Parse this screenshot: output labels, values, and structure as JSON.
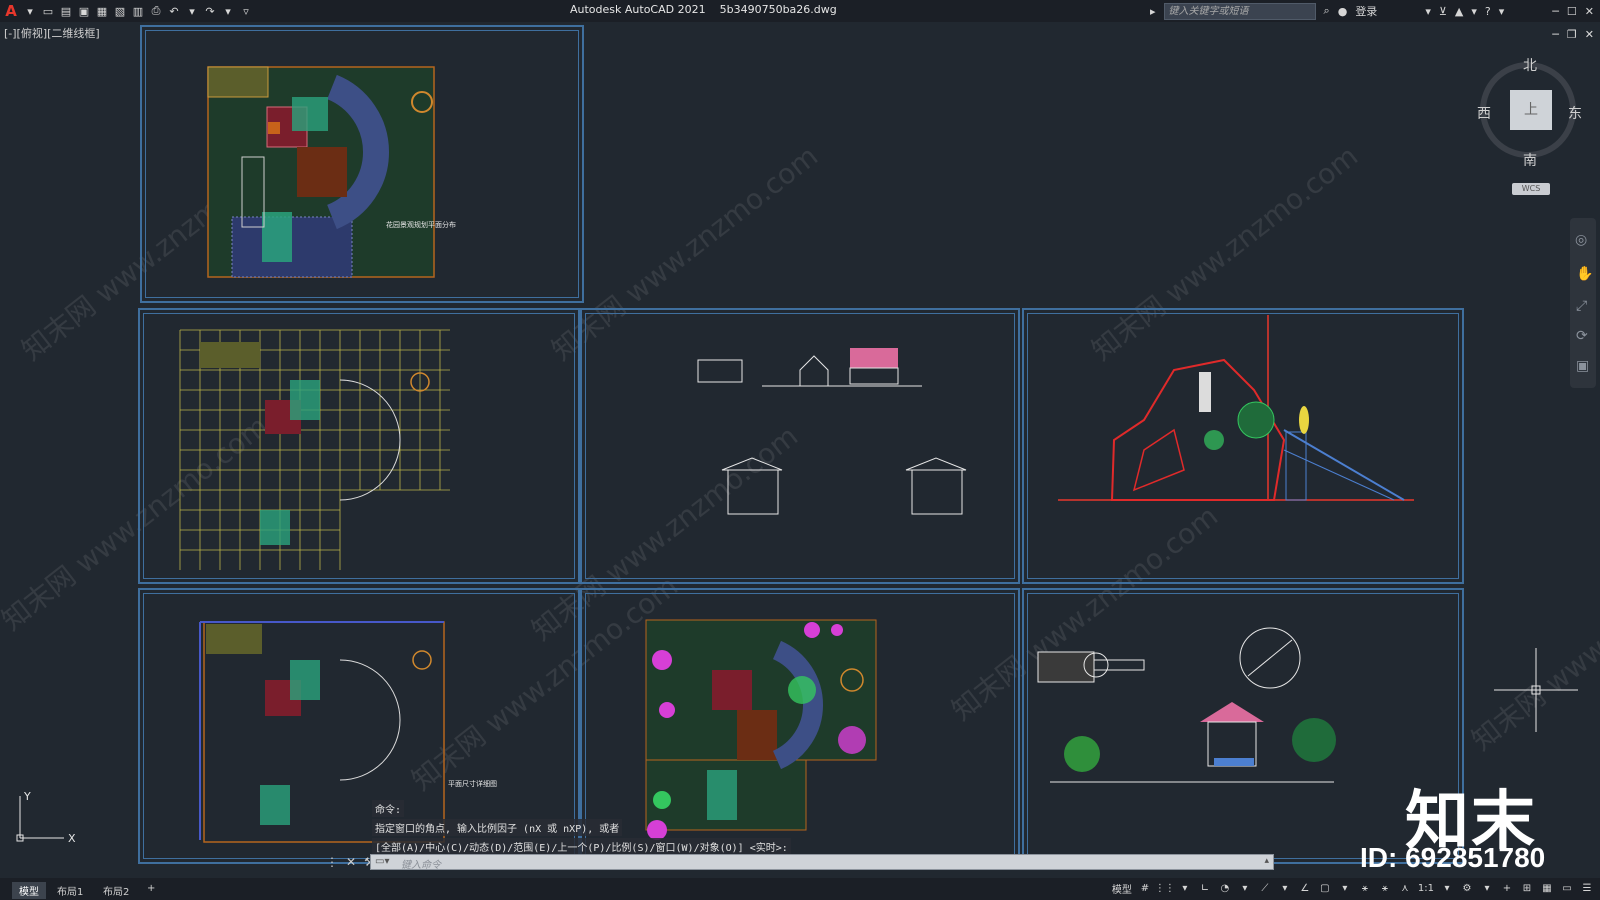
{
  "window": {
    "title": "Autodesk AutoCAD 2021",
    "filename": "5b3490750ba26.dwg",
    "search_placeholder": "键入关键字或短语",
    "login_label": "登录",
    "view_label": "[-][俯视][二维线框]"
  },
  "viewcube": {
    "top_face": "上",
    "north": "北",
    "south": "南",
    "east": "东",
    "west": "西",
    "wcs_label": "WCS"
  },
  "drawing": {
    "plan_title_1": "花园景观规划平面分布",
    "plan_title_2": "平面尺寸详细图"
  },
  "watermark": "知末网 www.znzmo.com",
  "command": {
    "prompt": "命令:",
    "line1": "指定窗口的角点, 输入比例因子 (nX 或 nXP), 或者",
    "line2": "[全部(A)/中心(C)/动态(D)/范围(E)/上一个(P)/比例(S)/窗口(W)/对象(O)] <实时>:",
    "input_placeholder": "键入命令"
  },
  "tabs": [
    "模型",
    "布局1",
    "布局2"
  ],
  "status": {
    "model_label": "模型",
    "scale": "1:1"
  },
  "brand": {
    "name": "知末",
    "id": "ID: 692851780"
  },
  "colors": {
    "accent_red": "#e8372c",
    "viewport_border": "#3f6f9e",
    "background": "#212830"
  }
}
